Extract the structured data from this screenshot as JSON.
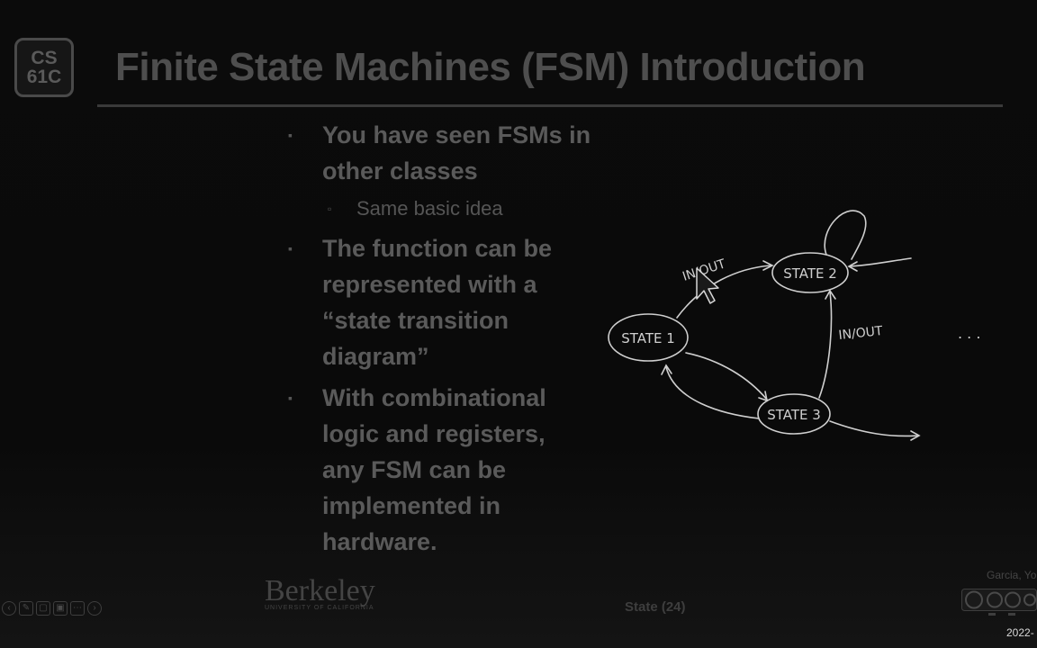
{
  "logo": {
    "line1": "CS",
    "line2": "61C"
  },
  "slide": {
    "title": "Finite State Machines (FSM) Introduction",
    "bullets": [
      {
        "text": "You have seen FSMs in other classes",
        "sub": [
          "Same basic idea"
        ]
      },
      {
        "text": "The function can be represented with a “state transition diagram”",
        "sub": []
      },
      {
        "text": "With combinational logic and registers, any FSM can be implemented in hardware.",
        "sub": []
      }
    ],
    "bullet_marker": "▪",
    "sub_marker": "▫"
  },
  "diagram": {
    "states": [
      "STATE 1",
      "STATE 2",
      "STATE 3"
    ],
    "edge_labels": [
      "IN/OUT",
      "IN/OUT"
    ],
    "ellipsis": ". . ."
  },
  "footer": {
    "institution": "Berkeley",
    "institution_sub": "UNIVERSITY OF CALIFORNIA",
    "slide_label": "State (24)",
    "author": "Garcia, Yo",
    "date": "2022-",
    "license_icon": "creative-commons-by-nc-icon"
  },
  "nav_icons": [
    "prev-icon",
    "pen-icon",
    "cc-icon",
    "screen-icon",
    "options-icon",
    "next-icon"
  ],
  "colors": {
    "background": "#0b0b0b",
    "text": "#5a5a5a",
    "diagram": "#cfcfcf"
  }
}
